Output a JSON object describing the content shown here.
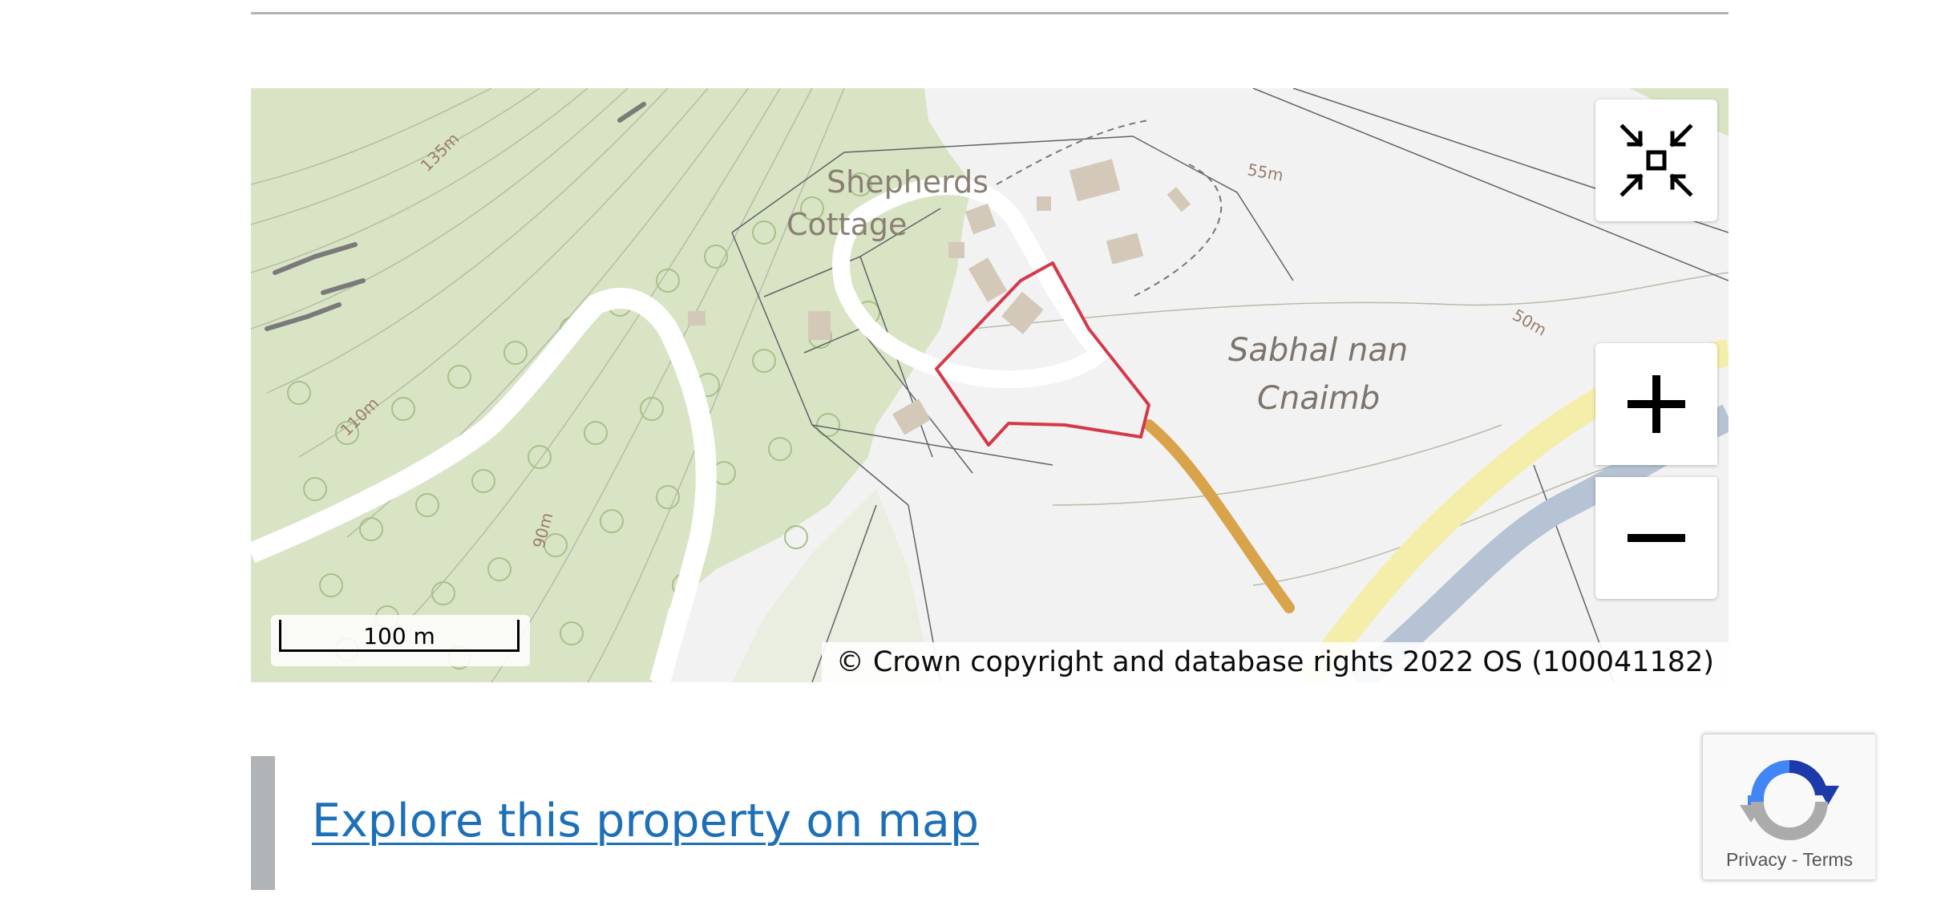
{
  "map": {
    "place_labels": {
      "shepherds_line1": "Shepherds",
      "shepherds_line2": "Cottage",
      "sabhal_line1": "Sabhal nan",
      "sabhal_line2": "Cnaimb"
    },
    "contour_labels": [
      "135m",
      "110m",
      "90m",
      "55m",
      "50m"
    ],
    "scale_bar": "100 m",
    "attribution": "© Crown copyright and database rights 2022 OS (100041182)",
    "controls": {
      "fit_label": "fit-to-boundary",
      "zoom_in_label": "+",
      "zoom_out_label": "−"
    },
    "colors": {
      "woodland": "#d9e4c4",
      "tree_symbol": "#a8c08a",
      "land": "#f2f2f2",
      "road_white": "#ffffff",
      "track_yellow": "#f4eeaa",
      "river_blue": "#b6c3d4",
      "building": "#d4c8b8",
      "property_boundary": "#d4394a",
      "access_track": "#d8a34a"
    }
  },
  "explore": {
    "link_text": "Explore this property on map",
    "accent_color": "#1d70b8"
  },
  "recaptcha": {
    "privacy": "Privacy",
    "separator": "-",
    "terms": "Terms"
  }
}
